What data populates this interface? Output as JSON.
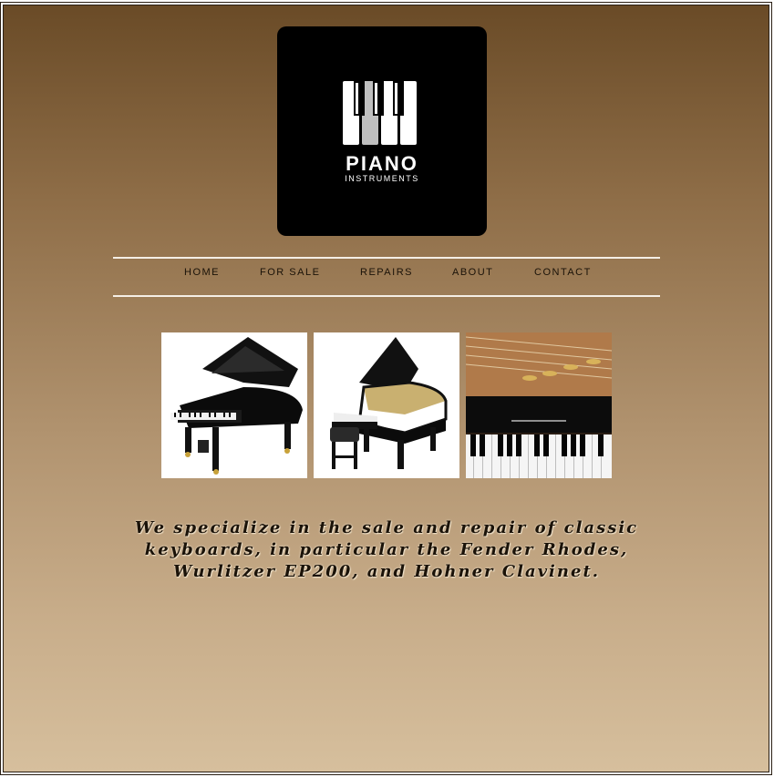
{
  "logo": {
    "title": "PIANO",
    "subtitle": "INSTRUMENTS"
  },
  "nav": {
    "items": [
      {
        "label": "HOME"
      },
      {
        "label": "FOR SALE"
      },
      {
        "label": "REPAIRS"
      },
      {
        "label": "ABOUT"
      },
      {
        "label": "CONTACT"
      }
    ]
  },
  "gallery": {
    "images": [
      {
        "name": "grand-piano-photo"
      },
      {
        "name": "grand-piano-with-bench-photo"
      },
      {
        "name": "piano-keys-interior-photo"
      }
    ]
  },
  "main": {
    "tagline": "We specialize in the sale and repair of classic keyboards, in particular the Fender Rhodes, Wurlitzer EP200, and Hohner Clavinet."
  },
  "colors": {
    "gradient_top": "#6a4b27",
    "gradient_bottom": "#d6bf9d",
    "logo_bg": "#000000",
    "text": "#1a1208"
  }
}
